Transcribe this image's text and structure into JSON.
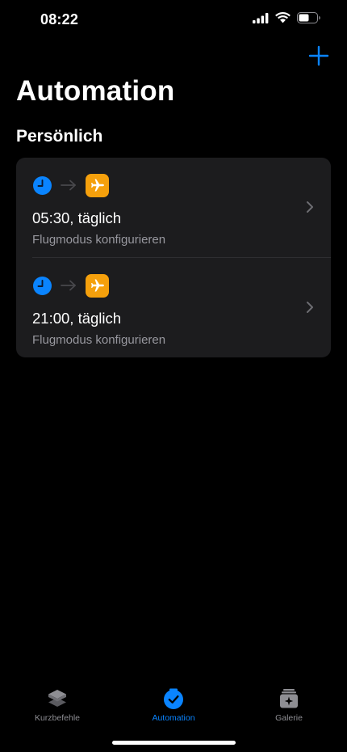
{
  "status_bar": {
    "time": "08:22",
    "icons": [
      "cellular-signal-icon",
      "wifi-icon",
      "battery-icon"
    ]
  },
  "nav": {
    "add_icon": "plus-icon"
  },
  "page_title": "Automation",
  "section_title": "Persönlich",
  "automations": [
    {
      "trigger_icon": "clock-icon",
      "action_icon": "airplane-icon",
      "title": "05:30, täglich",
      "subtitle": "Flugmodus konfigurieren"
    },
    {
      "trigger_icon": "clock-icon",
      "action_icon": "airplane-icon",
      "title": "21:00, täglich",
      "subtitle": "Flugmodus konfigurieren"
    }
  ],
  "tab_bar": {
    "tabs": [
      {
        "label": "Kurzbefehle",
        "icon": "layers-icon",
        "active": false
      },
      {
        "label": "Automation",
        "icon": "clock-check-icon",
        "active": true
      },
      {
        "label": "Galerie",
        "icon": "gallery-icon",
        "active": false
      }
    ]
  },
  "colors": {
    "background": "#000000",
    "card": "#1c1c1e",
    "accent": "#0a84ff",
    "action_orange": "#f5a00c",
    "secondary_text": "#98989f",
    "inactive_tab": "#8e8e93"
  }
}
